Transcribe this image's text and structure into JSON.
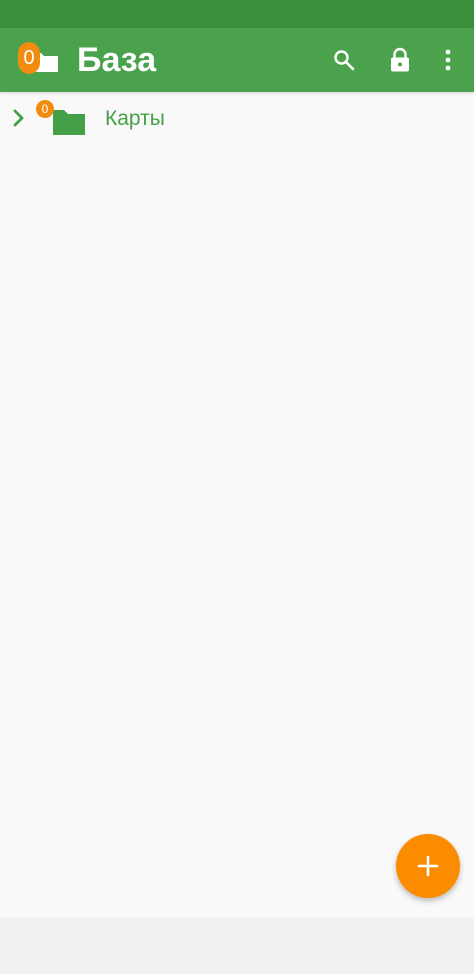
{
  "app_bar": {
    "title": "База",
    "logo_badge": "0",
    "colors": {
      "status_bar": "#3a8f3d",
      "app_bar": "#4aa34c",
      "badge": "#f28c0f"
    },
    "actions": [
      {
        "icon": "search-icon"
      },
      {
        "icon": "lock-icon"
      },
      {
        "icon": "more-vert-icon"
      }
    ]
  },
  "tree": {
    "nodes": [
      {
        "label": "Карты",
        "badge": "0",
        "icon": "folder-icon",
        "expand_icon": "chevron-right-icon",
        "expanded": false
      }
    ]
  },
  "fab": {
    "icon": "plus-icon",
    "color": "#fb8c00"
  }
}
